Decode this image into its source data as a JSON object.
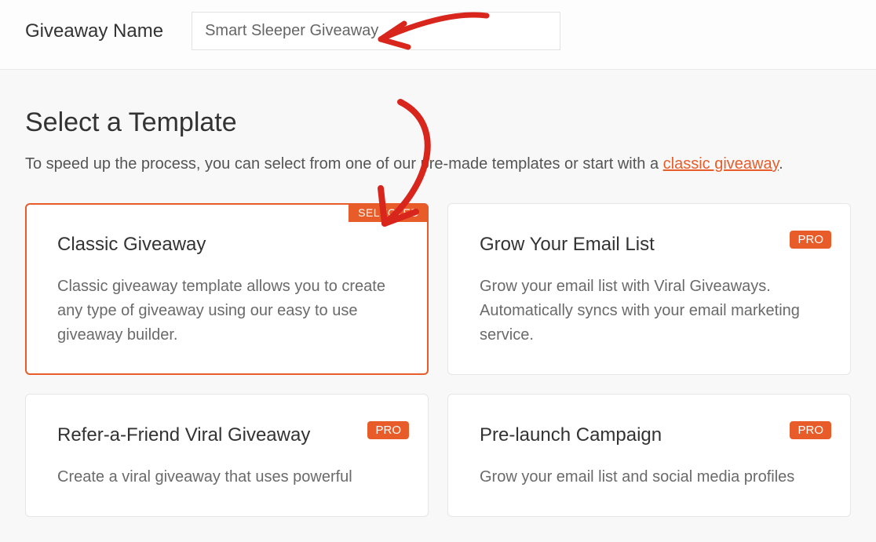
{
  "header": {
    "label": "Giveaway Name",
    "value": "Smart Sleeper Giveaway"
  },
  "section": {
    "title": "Select a Template",
    "desc_prefix": "To speed up the process, you can select from one of our pre-made templates or start with a ",
    "desc_link": "classic giveaway",
    "desc_suffix": "."
  },
  "badges": {
    "selected": "SELECTED",
    "pro": "PRO"
  },
  "templates": [
    {
      "title": "Classic Giveaway",
      "desc": "Classic giveaway template allows you to create any type of giveaway using our easy to use giveaway builder.",
      "selected": true,
      "pro": false
    },
    {
      "title": "Grow Your Email List",
      "desc": "Grow your email list with Viral Giveaways. Automatically syncs with your email marketing service.",
      "selected": false,
      "pro": true
    },
    {
      "title": "Refer-a-Friend Viral Giveaway",
      "desc": "Create a viral giveaway that uses powerful",
      "selected": false,
      "pro": true
    },
    {
      "title": "Pre-launch Campaign",
      "desc": "Grow your email list and social media profiles",
      "selected": false,
      "pro": true
    }
  ],
  "colors": {
    "accent": "#e85c2a",
    "annotation": "#d9261c"
  }
}
